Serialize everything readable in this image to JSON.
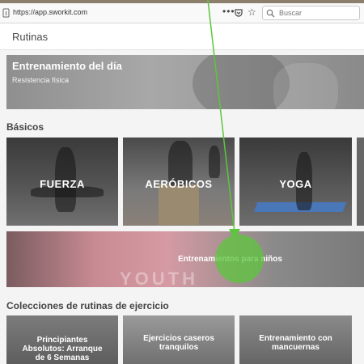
{
  "browser": {
    "url": "https://app.sworkit.com",
    "search_placeholder": "Buscar"
  },
  "header": {
    "title": "Rutinas"
  },
  "daily": {
    "title": "Entrenamiento del día",
    "subtitle": "Resistencia física"
  },
  "basics": {
    "heading": "Básicos",
    "cards": [
      {
        "label": "FUERZA"
      },
      {
        "label": "AERÓBICOS"
      },
      {
        "label": "YOGA"
      }
    ]
  },
  "kids": {
    "label": "Entrenamientos para niños",
    "watermark": "YOUTH"
  },
  "collections": {
    "heading": "Colecciones de rutinas de ejercicio",
    "cards": [
      {
        "label": "Principiantes\nAbsolutos: Arranque\nde 6 Semanas"
      },
      {
        "label": "Ejercicios caseros\ntranquilos"
      },
      {
        "label": "Entrenamiento con\nmancuernas"
      }
    ]
  },
  "colors": {
    "pointer": "#5cc63c",
    "mat": "#4a77b8"
  },
  "icons": [
    "info-icon",
    "more-dots-icon",
    "pocket-icon",
    "bookmark-star-icon",
    "search-icon"
  ]
}
